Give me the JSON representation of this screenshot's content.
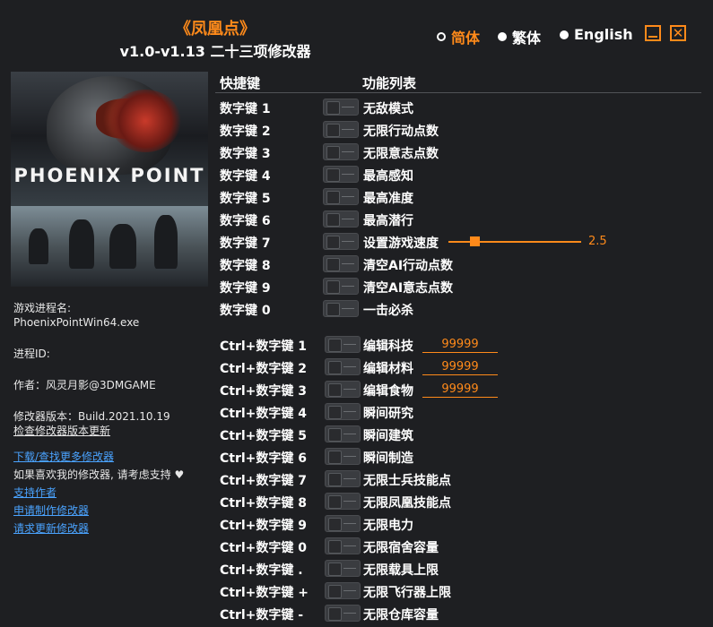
{
  "header": {
    "title": "《凤凰点》",
    "subtitle": "v1.0-v1.13 二十三项修改器",
    "languages": [
      "简体",
      "繁体",
      "English"
    ],
    "selected_language": "简体"
  },
  "colors": {
    "accent": "#ff8a1a",
    "background": "#1e1f22",
    "link": "#4aa3ff"
  },
  "cover": {
    "logo_text": "PHOENIX POINT"
  },
  "info": {
    "process_label": "游戏进程名:",
    "process_value": "PhoenixPointWin64.exe",
    "pid_label": "进程ID:",
    "author": "作者：风灵月影@3DMGAME",
    "version": "修改器版本：Build.2021.10.19",
    "check_update": "检查修改器版本更新",
    "download_more": "下载/查找更多修改器",
    "support_msg": "如果喜欢我的修改器, 请考虑支持",
    "support_author": "支持作者",
    "request_custom": "申请制作修改器",
    "request_update": "请求更新修改器"
  },
  "columns": {
    "hotkey": "快捷键",
    "functions": "功能列表"
  },
  "rows": [
    {
      "key": "数字键 1",
      "func": "无敌模式"
    },
    {
      "key": "数字键 2",
      "func": "无限行动点数"
    },
    {
      "key": "数字键 3",
      "func": "无限意志点数"
    },
    {
      "key": "数字键 4",
      "func": "最高感知"
    },
    {
      "key": "数字键 5",
      "func": "最高准度"
    },
    {
      "key": "数字键 6",
      "func": "最高潜行"
    },
    {
      "key": "数字键 7",
      "func": "设置游戏速度",
      "slider_value": "2.5"
    },
    {
      "key": "数字键 8",
      "func": "清空AI行动点数"
    },
    {
      "key": "数字键 9",
      "func": "清空AI意志点数"
    },
    {
      "key": "数字键 0",
      "func": "一击必杀"
    },
    {
      "key": "Ctrl+数字键 1",
      "func": "编辑科技",
      "edit_value": "99999"
    },
    {
      "key": "Ctrl+数字键 2",
      "func": "编辑材料",
      "edit_value": "99999"
    },
    {
      "key": "Ctrl+数字键 3",
      "func": "编辑食物",
      "edit_value": "99999"
    },
    {
      "key": "Ctrl+数字键 4",
      "func": "瞬间研究"
    },
    {
      "key": "Ctrl+数字键 5",
      "func": "瞬间建筑"
    },
    {
      "key": "Ctrl+数字键 6",
      "func": "瞬间制造"
    },
    {
      "key": "Ctrl+数字键 7",
      "func": "无限士兵技能点"
    },
    {
      "key": "Ctrl+数字键 8",
      "func": "无限凤凰技能点"
    },
    {
      "key": "Ctrl+数字键 9",
      "func": "无限电力"
    },
    {
      "key": "Ctrl+数字键 0",
      "func": "无限宿舍容量"
    },
    {
      "key": "Ctrl+数字键 .",
      "func": "无限载具上限"
    },
    {
      "key": "Ctrl+数字键 +",
      "func": "无限飞行器上限"
    },
    {
      "key": "Ctrl+数字键 -",
      "func": "无限仓库容量"
    }
  ]
}
